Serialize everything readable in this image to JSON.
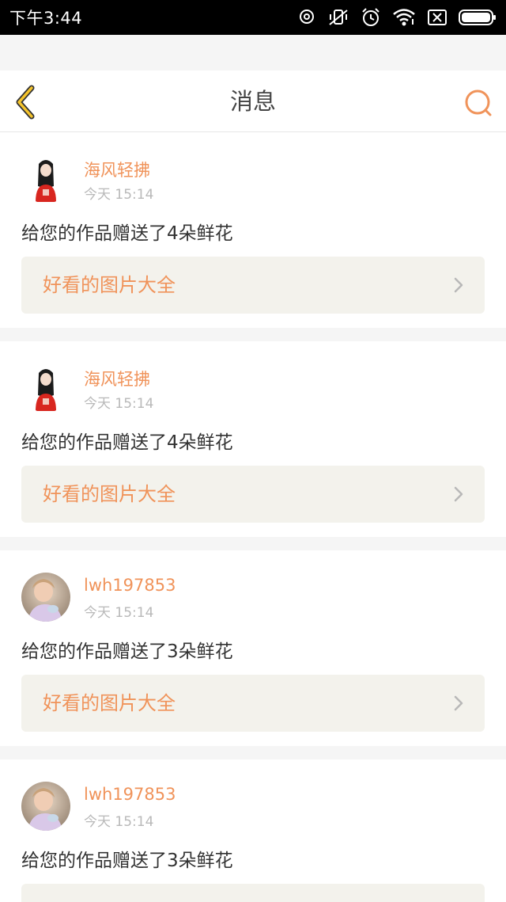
{
  "status_bar": {
    "time": "下午3:44",
    "icons": [
      "qq-icon",
      "mute-icon",
      "alarm-icon",
      "wifi-icon",
      "sim-off-icon",
      "battery-icon"
    ]
  },
  "header": {
    "title": "消息",
    "back_icon": "back-chevron-icon",
    "search_icon": "search-icon",
    "accent_color": "#f0935a"
  },
  "messages": [
    {
      "name": "海风轻拂",
      "time": "今天 15:14",
      "text": "给您的作品赠送了4朵鲜花",
      "link": "好看的图片大全",
      "avatar": "avatar-girl-red"
    },
    {
      "name": "海风轻拂",
      "time": "今天 15:14",
      "text": "给您的作品赠送了4朵鲜花",
      "link": "好看的图片大全",
      "avatar": "avatar-girl-red"
    },
    {
      "name": "lwh197853",
      "time": "今天 15:14",
      "text": "给您的作品赠送了3朵鲜花",
      "link": "好看的图片大全",
      "avatar": "avatar-child-photo"
    },
    {
      "name": "lwh197853",
      "time": "今天 15:14",
      "text": "给您的作品赠送了3朵鲜花",
      "link": "",
      "avatar": "avatar-child-photo"
    }
  ]
}
